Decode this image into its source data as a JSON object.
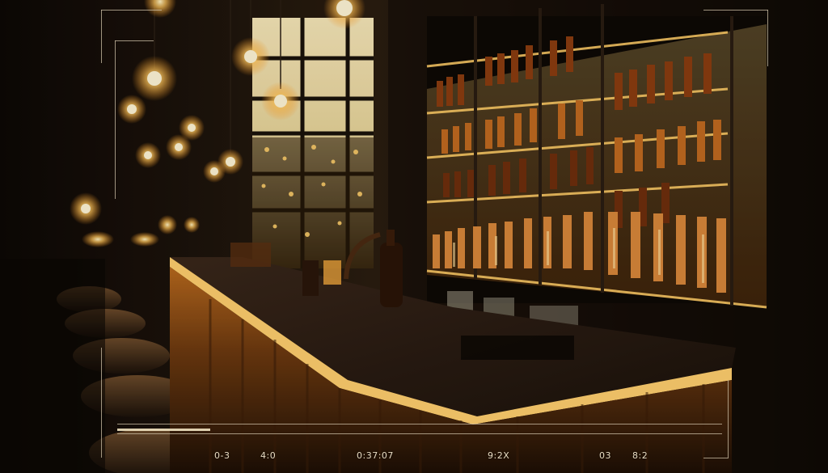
{
  "scene": {
    "subject": "bar-counter-with-backlit-bottle-shelves",
    "palette": {
      "amber": "#f2a33a",
      "glow": "#ffd57a",
      "wall": "#1a130c",
      "counter": "#2a1c12",
      "dark": "#050302"
    }
  },
  "overlay": {
    "timecodes": [
      "0-3",
      "4:0",
      "0:37:07",
      "9:2X",
      "03",
      "8:2"
    ]
  }
}
